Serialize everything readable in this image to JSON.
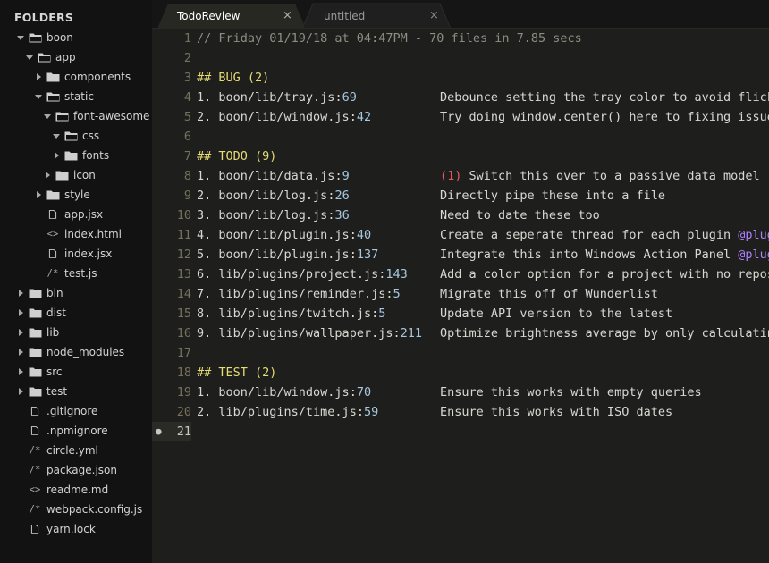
{
  "sidebar": {
    "title": "FOLDERS",
    "items": [
      {
        "label": "boon",
        "type": "folder",
        "open": true,
        "depth": 0
      },
      {
        "label": "app",
        "type": "folder",
        "open": true,
        "depth": 1
      },
      {
        "label": "components",
        "type": "folder",
        "open": false,
        "depth": 2
      },
      {
        "label": "static",
        "type": "folder",
        "open": true,
        "depth": 2
      },
      {
        "label": "font-awesome",
        "type": "folder",
        "open": true,
        "depth": 3
      },
      {
        "label": "css",
        "type": "folder",
        "open": true,
        "depth": 4
      },
      {
        "label": "fonts",
        "type": "folder",
        "open": false,
        "depth": 4
      },
      {
        "label": "icon",
        "type": "folder",
        "open": false,
        "depth": 3
      },
      {
        "label": "style",
        "type": "folder",
        "open": false,
        "depth": 2
      },
      {
        "label": "app.jsx",
        "type": "file",
        "glyph": "file-icon",
        "depth": 2
      },
      {
        "label": "index.html",
        "type": "file",
        "glyph": "code-icon",
        "depth": 2
      },
      {
        "label": "index.jsx",
        "type": "file",
        "glyph": "file-icon",
        "depth": 2
      },
      {
        "label": "test.js",
        "type": "file",
        "glyph": "comment-icon",
        "depth": 2
      },
      {
        "label": "bin",
        "type": "folder",
        "open": false,
        "depth": 0
      },
      {
        "label": "dist",
        "type": "folder",
        "open": false,
        "depth": 0
      },
      {
        "label": "lib",
        "type": "folder",
        "open": false,
        "depth": 0
      },
      {
        "label": "node_modules",
        "type": "folder",
        "open": false,
        "depth": 0
      },
      {
        "label": "src",
        "type": "folder",
        "open": false,
        "depth": 0
      },
      {
        "label": "test",
        "type": "folder",
        "open": false,
        "depth": 0
      },
      {
        "label": ".gitignore",
        "type": "file",
        "glyph": "file-icon",
        "depth": 0
      },
      {
        "label": ".npmignore",
        "type": "file",
        "glyph": "file-icon",
        "depth": 0
      },
      {
        "label": "circle.yml",
        "type": "file",
        "glyph": "comment-icon",
        "depth": 0
      },
      {
        "label": "package.json",
        "type": "file",
        "glyph": "comment-icon",
        "depth": 0
      },
      {
        "label": "readme.md",
        "type": "file",
        "glyph": "code-icon",
        "depth": 0
      },
      {
        "label": "webpack.config.js",
        "type": "file",
        "glyph": "comment-icon",
        "depth": 0
      },
      {
        "label": "yarn.lock",
        "type": "file",
        "glyph": "file-icon",
        "depth": 0
      }
    ]
  },
  "tabs": [
    {
      "label": "TodoReview",
      "active": true,
      "close": "×"
    },
    {
      "label": "untitled",
      "active": false,
      "close": "×"
    }
  ],
  "editor": {
    "active_line": "21",
    "lines": [
      {
        "n": "1",
        "kind": "comment",
        "text": "// Friday 01/19/18 at 04:47PM - 70 files in 7.85 secs"
      },
      {
        "n": "2",
        "kind": "blank"
      },
      {
        "n": "3",
        "kind": "heading",
        "hash": "## ",
        "title": "BUG ",
        "count": "(2)"
      },
      {
        "n": "4",
        "kind": "item",
        "idx": "1. ",
        "path": "boon/lib/tray.js",
        "sep": ":",
        "ln": "69",
        "desc": "Debounce setting the tray color to avoid flickering"
      },
      {
        "n": "5",
        "kind": "item",
        "idx": "2. ",
        "path": "boon/lib/window.js",
        "sep": ":",
        "ln": "42",
        "desc": "Try doing window.center() here to fixing issues"
      },
      {
        "n": "6",
        "kind": "blank"
      },
      {
        "n": "7",
        "kind": "heading",
        "hash": "## ",
        "title": "TODO ",
        "count": "(9)"
      },
      {
        "n": "8",
        "kind": "item",
        "idx": "1. ",
        "path": "boon/lib/data.js",
        "sep": ":",
        "ln": "9",
        "prio": "(1) ",
        "desc": "Switch this over to a passive data model"
      },
      {
        "n": "9",
        "kind": "item",
        "idx": "2. ",
        "path": "boon/lib/log.js",
        "sep": ":",
        "ln": "26",
        "desc": "Directly pipe these into a file"
      },
      {
        "n": "10",
        "kind": "item",
        "idx": "3. ",
        "path": "boon/lib/log.js",
        "sep": ":",
        "ln": "36",
        "desc": "Need to date these too"
      },
      {
        "n": "11",
        "kind": "item",
        "idx": "4. ",
        "path": "boon/lib/plugin.js",
        "sep": ":",
        "ln": "40",
        "desc": "Create a seperate thread for each plugin ",
        "mention": "@plugins"
      },
      {
        "n": "12",
        "kind": "item",
        "idx": "5. ",
        "path": "boon/lib/plugin.js",
        "sep": ":",
        "ln": "137",
        "desc": "Integrate this into Windows Action Panel ",
        "mention": "@plugins"
      },
      {
        "n": "13",
        "kind": "item",
        "idx": "6. ",
        "path": "lib/plugins/project.js",
        "sep": ":",
        "ln": "143",
        "desc": "Add a color option for a project with no repository"
      },
      {
        "n": "14",
        "kind": "item",
        "idx": "7. ",
        "path": "lib/plugins/reminder.js",
        "sep": ":",
        "ln": "5",
        "desc": "Migrate this off of Wunderlist"
      },
      {
        "n": "15",
        "kind": "item",
        "idx": "8. ",
        "path": "lib/plugins/twitch.js",
        "sep": ":",
        "ln": "5",
        "desc": "Update API version to the latest"
      },
      {
        "n": "16",
        "kind": "item",
        "idx": "9. ",
        "path": "lib/plugins/wallpaper.js",
        "sep": ":",
        "ln": "211",
        "desc": "Optimize brightness average by only calculating"
      },
      {
        "n": "17",
        "kind": "blank"
      },
      {
        "n": "18",
        "kind": "heading",
        "hash": "## ",
        "title": "TEST ",
        "count": "(2)"
      },
      {
        "n": "19",
        "kind": "item",
        "idx": "1. ",
        "path": "boon/lib/window.js",
        "sep": ":",
        "ln": "70",
        "desc": "Ensure this works with empty queries"
      },
      {
        "n": "20",
        "kind": "item",
        "idx": "2. ",
        "path": "lib/plugins/time.js",
        "sep": ":",
        "ln": "59",
        "desc": "Ensure this works with ISO dates"
      },
      {
        "n": "21",
        "kind": "blank"
      }
    ]
  }
}
